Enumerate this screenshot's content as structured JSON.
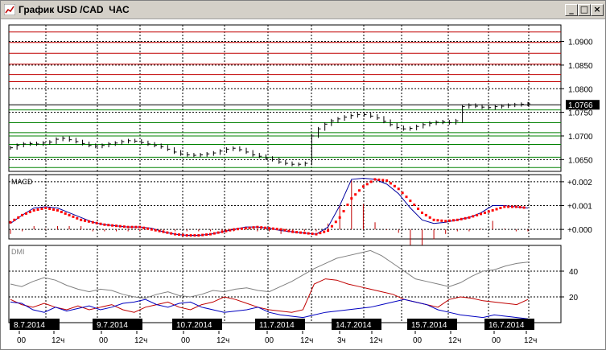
{
  "window": {
    "title": "График USD /CAD  ЧАС",
    "buttons": {
      "minimize": "_",
      "maximize": "□",
      "close": "×"
    }
  },
  "colors": {
    "price_bar": "#000000",
    "macd_line": "#0000a0",
    "signal_dots": "#ff0000",
    "histogram": "#c00000",
    "dmi_adx": "#808080",
    "dmi_plus": "#c00000",
    "dmi_minus": "#0000c0",
    "h_red": "#c00000",
    "h_green": "#008000"
  },
  "chart_data": [
    {
      "type": "line",
      "title": "",
      "ylim": [
        1.0625,
        1.0935
      ],
      "y_ticks": [
        "1.0650",
        "1.0700",
        "1.0750",
        "1.0800",
        "1.0850",
        "1.0900"
      ],
      "y_tick_values": [
        1.065,
        1.07,
        1.075,
        1.08,
        1.085,
        1.09
      ],
      "current_price_label": "1.0766",
      "current_price": 1.0766,
      "series": [
        {
          "values": [
            1.0675,
            1.068,
            1.0683,
            1.0684,
            1.0683,
            1.0685,
            1.0687,
            1.0693,
            1.0695,
            1.0692,
            1.0688,
            1.0684,
            1.068,
            1.0678,
            1.068,
            1.0683,
            1.0685,
            1.0688,
            1.069,
            1.0689,
            1.0686,
            1.0683,
            1.068,
            1.0677,
            1.0672,
            1.0666,
            1.0662,
            1.066,
            1.0659,
            1.066,
            1.0662,
            1.0664,
            1.0668,
            1.0672,
            1.0674,
            1.0671,
            1.0666,
            1.066,
            1.0657,
            1.0653,
            1.065,
            1.0645,
            1.0642,
            1.064,
            1.064,
            1.0642,
            1.07,
            1.0715,
            1.0725,
            1.0732,
            1.0736,
            1.074,
            1.0743,
            1.0745,
            1.0745,
            1.0742,
            1.0738,
            1.0731,
            1.0724,
            1.0718,
            1.0715,
            1.0716,
            1.072,
            1.0724,
            1.0727,
            1.0729,
            1.073,
            1.0728,
            1.0732,
            1.0762,
            1.0765,
            1.0763,
            1.0761,
            1.076,
            1.0762,
            1.0763,
            1.0765,
            1.0766,
            1.0767,
            1.0768
          ]
        }
      ]
    },
    {
      "type": "line",
      "title": "MACD",
      "ylim": [
        -0.0004,
        0.0023
      ],
      "y_ticks": [
        "+0.002",
        "+0.001",
        "+0.000"
      ],
      "y_tick_values": [
        0.002,
        0.001,
        0.0
      ],
      "series": [
        {
          "values": [
            0.00025,
            0.0006,
            0.0009,
            0.00095,
            0.0009,
            0.0007,
            0.0005,
            0.0003,
            0.0002,
            0.00015,
            0.0001,
            0.0001,
            5e-05,
            -0.0001,
            -0.0002,
            -0.00025,
            -0.00025,
            -0.0002,
            -0.0001,
            0.0,
            0.0001,
            0.0001,
            5e-05,
            -5e-05,
            -0.0001,
            -0.00015,
            -0.0002,
            0.0001,
            0.001,
            0.0021,
            0.00215,
            0.0021,
            0.0019,
            0.0015,
            0.0009,
            0.0004,
            0.00025,
            0.0003,
            0.0004,
            0.0005,
            0.0007,
            0.001,
            0.001,
            0.00095,
            0.0009
          ]
        },
        {
          "values": [
            0.0003,
            0.0006,
            0.0008,
            0.0009,
            0.0008,
            0.0006,
            0.0004,
            0.0003,
            0.0002,
            0.00015,
            0.0001,
            0.0001,
            0.0,
            -0.0001,
            -0.0002,
            -0.00025,
            -0.00025,
            -0.0002,
            -0.0001,
            0.0,
            5e-05,
            0.0001,
            5e-05,
            0.0,
            -0.0001,
            -0.00015,
            -0.0002,
            -5e-05,
            0.0005,
            0.0013,
            0.0018,
            0.0021,
            0.00205,
            0.0017,
            0.0012,
            0.0007,
            0.0004,
            0.00035,
            0.0004,
            0.0005,
            0.00065,
            0.0008,
            0.00095,
            0.00095,
            0.0009
          ]
        }
      ]
    },
    {
      "type": "line",
      "title": "DMI",
      "ylim": [
        0,
        60
      ],
      "y_ticks": [
        "40",
        "20"
      ],
      "y_tick_values": [
        40,
        20
      ],
      "series": [
        {
          "values": [
            30,
            28,
            32,
            35,
            33,
            29,
            26,
            24,
            26,
            25,
            22,
            20,
            19,
            22,
            24,
            21,
            20,
            22,
            25,
            24,
            26,
            27,
            25,
            24,
            28,
            32,
            37,
            42,
            46,
            50,
            52,
            54,
            56,
            52,
            46,
            40,
            34,
            32,
            30,
            28,
            31,
            36,
            40,
            41,
            44,
            46,
            47
          ]
        },
        {
          "values": [
            18,
            14,
            12,
            15,
            12,
            10,
            13,
            10,
            12,
            14,
            10,
            8,
            12,
            14,
            16,
            12,
            10,
            14,
            16,
            20,
            18,
            15,
            12,
            10,
            9,
            8,
            10,
            30,
            34,
            33,
            30,
            28,
            26,
            24,
            22,
            18,
            16,
            14,
            12,
            18,
            20,
            19,
            17,
            16,
            15,
            14,
            18
          ]
        },
        {
          "values": [
            16,
            15,
            10,
            8,
            12,
            9,
            11,
            13,
            10,
            12,
            15,
            16,
            18,
            14,
            12,
            15,
            16,
            12,
            10,
            8,
            9,
            10,
            12,
            8,
            6,
            5,
            4,
            6,
            8,
            9,
            10,
            11,
            12,
            14,
            16,
            18,
            16,
            14,
            10,
            8,
            6,
            5,
            4,
            6,
            5,
            4,
            3
          ]
        }
      ]
    }
  ],
  "x_axis": {
    "dates": [
      "8.7.2014",
      "9.7.2014",
      "10.7.2014",
      "11.7.2014",
      "14.7.2014",
      "15.7.2014",
      "16.7.2014"
    ],
    "hours": [
      [
        "00",
        "12ч"
      ],
      [
        "00",
        "12ч"
      ],
      [
        "00",
        "12ч"
      ],
      [
        "00",
        "12ч"
      ],
      [
        "3ч",
        "12ч"
      ],
      [
        "00",
        "12ч"
      ],
      [
        "00",
        "12ч"
      ]
    ]
  }
}
